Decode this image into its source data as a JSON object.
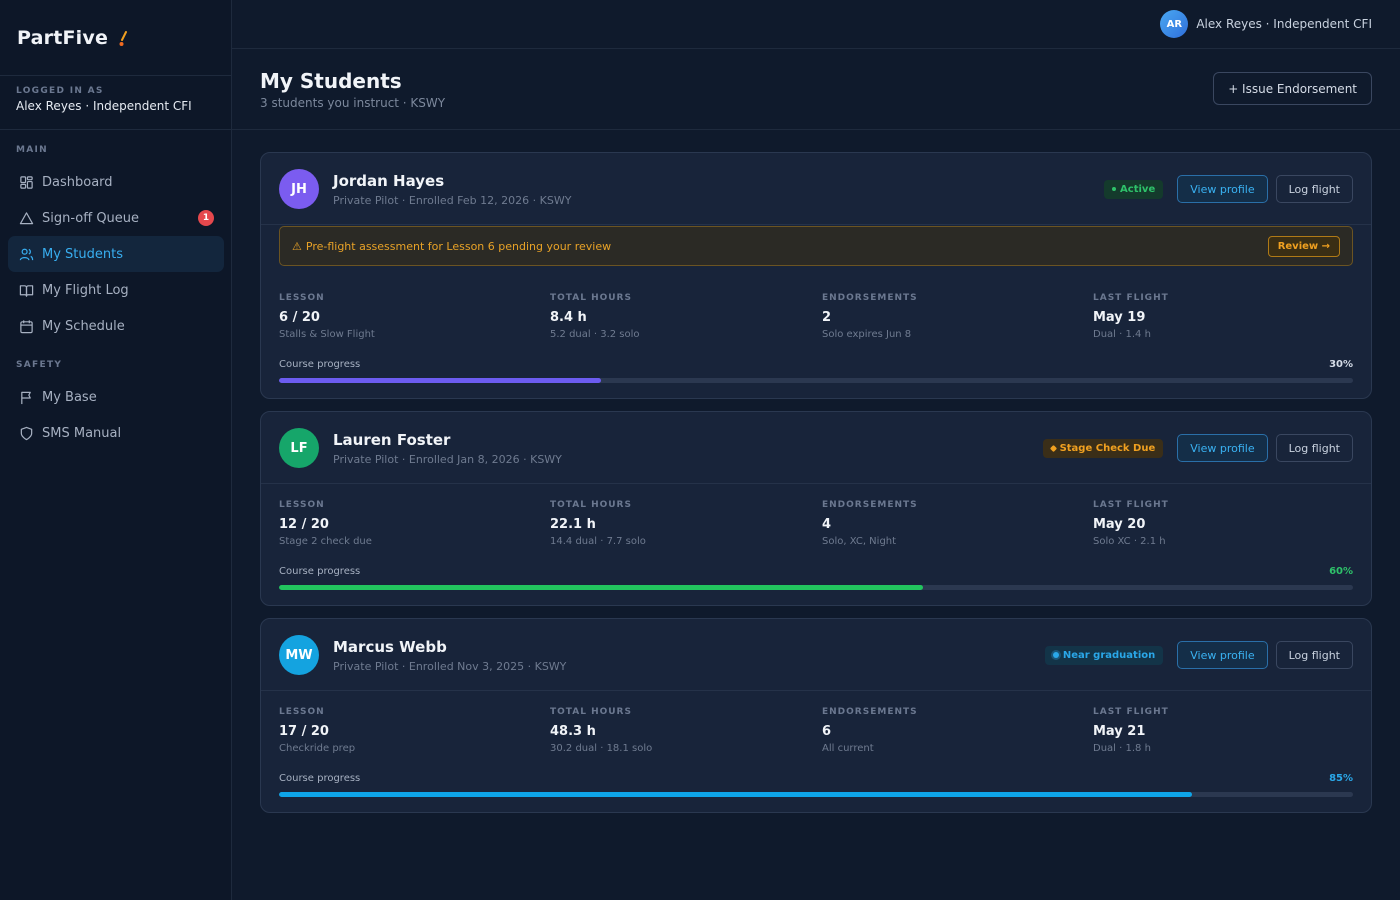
{
  "app": {
    "brand": "PartFive"
  },
  "sidebar": {
    "logged_caption": "LOGGED IN AS",
    "logged_user": "Alex Reyes · Independent CFI",
    "section_main": "MAIN",
    "section_safety": "SAFETY",
    "main_items": [
      {
        "label": "Dashboard",
        "icon": "grid-icon"
      },
      {
        "label": "Sign-off Queue",
        "icon": "triangle-alert-icon",
        "badge": "1"
      },
      {
        "label": "My Students",
        "icon": "users-icon",
        "active": true
      },
      {
        "label": "My Flight Log",
        "icon": "book-icon"
      },
      {
        "label": "My Schedule",
        "icon": "calendar-icon"
      }
    ],
    "safety_items": [
      {
        "label": "My Base",
        "icon": "flag-icon"
      },
      {
        "label": "SMS Manual",
        "icon": "shield-icon"
      }
    ]
  },
  "topbar": {
    "avatar_initials": "AR",
    "user": "Alex Reyes · Independent CFI"
  },
  "header": {
    "title": "My Students",
    "subtitle": "3 students you instruct · KSWY",
    "issue_button": "+ Issue Endorsement"
  },
  "labels": {
    "lesson": "LESSON",
    "total_hours": "TOTAL HOURS",
    "endorsements": "ENDORSEMENTS",
    "last_flight": "LAST FLIGHT",
    "course_progress": "Course progress",
    "view_profile": "View profile",
    "log_flight": "Log flight"
  },
  "students": [
    {
      "initials": "JH",
      "avatar_color": "#7b5cf0",
      "name": "Jordan Hayes",
      "meta": "Private Pilot · Enrolled Feb 12, 2026 · KSWY",
      "status": "Active",
      "alert": "Pre-flight assessment for Lesson 6 pending your review",
      "alert_icon": "⚠",
      "alert_button": "Review →",
      "lesson": "6 / 20",
      "lesson_sub": "Stalls & Slow Flight",
      "hours": "8.4 h",
      "hours_sub": "5.2 dual · 3.2 solo",
      "endorsements": "2",
      "endorsements_sub": "Solo expires Jun 8",
      "last_flight": "May 19",
      "last_flight_sub": "Dual · 1.4 h",
      "progress_pct": "30%",
      "progress": 30,
      "progress_color": "#6c5cf0",
      "pct_color": "#d5dce7"
    },
    {
      "initials": "LF",
      "avatar_color": "#16a66a",
      "name": "Lauren Foster",
      "meta": "Private Pilot · Enrolled Jan 8, 2026 · KSWY",
      "status": "Stage Check Due",
      "lesson": "12 / 20",
      "lesson_sub": "Stage 2 check due",
      "hours": "22.1 h",
      "hours_sub": "14.4 dual · 7.7 solo",
      "endorsements": "4",
      "endorsements_sub": "Solo, XC, Night",
      "last_flight": "May 20",
      "last_flight_sub": "Solo XC · 2.1 h",
      "progress_pct": "60%",
      "progress": 60,
      "progress_color": "#22c55e",
      "pct_color": "#2ec26a"
    },
    {
      "initials": "MW",
      "avatar_color": "#14a3e0",
      "name": "Marcus Webb",
      "meta": "Private Pilot · Enrolled Nov 3, 2025 · KSWY",
      "status": "Near graduation",
      "lesson": "17 / 20",
      "lesson_sub": "Checkride prep",
      "hours": "48.3 h",
      "hours_sub": "30.2 dual · 18.1 solo",
      "endorsements": "6",
      "endorsements_sub": "All current",
      "last_flight": "May 21",
      "last_flight_sub": "Dual · 1.8 h",
      "progress_pct": "85%",
      "progress": 85,
      "progress_color": "#0ea5e9",
      "pct_color": "#2aa7e8"
    }
  ]
}
